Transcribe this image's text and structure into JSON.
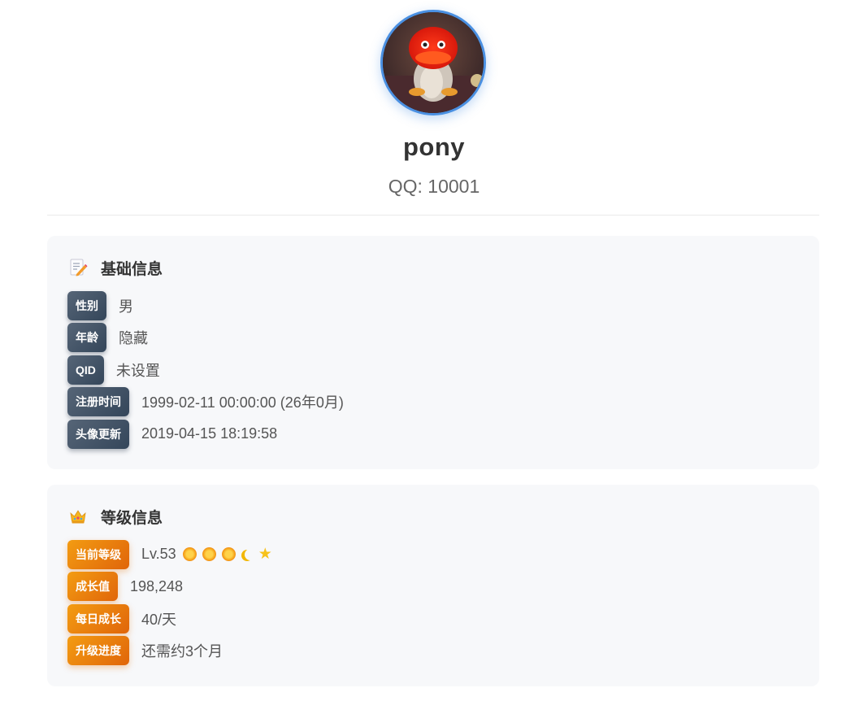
{
  "profile": {
    "name": "pony",
    "qq": "QQ: 10001"
  },
  "basic": {
    "icon": "memo-icon",
    "title": "基础信息",
    "rows": [
      {
        "label": "性别",
        "value": "男"
      },
      {
        "label": "年龄",
        "value": "隐藏"
      },
      {
        "label": "QID",
        "value": "未设置"
      },
      {
        "label": "注册时间",
        "value": "1999-02-11 00:00:00 (26年0月)"
      },
      {
        "label": "头像更新",
        "value": "2019-04-15 18:19:58"
      }
    ]
  },
  "level": {
    "icon": "crown-icon",
    "title": "等级信息",
    "rows": [
      {
        "label": "当前等级",
        "value": "Lv.53"
      },
      {
        "label": "成长值",
        "value": "198,248"
      },
      {
        "label": "每日成长",
        "value": "40/天"
      },
      {
        "label": "升级进度",
        "value": "还需约3个月"
      }
    ],
    "level_icons": [
      "sun-icon",
      "sun-icon",
      "sun-icon",
      "moon-icon",
      "star-icon"
    ]
  },
  "colors": {
    "avatar_border": "#4a90e2",
    "basic_tag": "#34465a",
    "level_tag": "#e67e22",
    "card_bg": "#f7f8fa"
  }
}
